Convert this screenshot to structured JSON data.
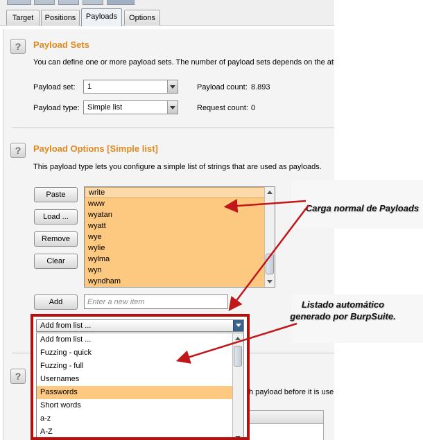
{
  "tabs": [
    {
      "label": "Target",
      "active": false
    },
    {
      "label": "Positions",
      "active": false
    },
    {
      "label": "Payloads",
      "active": true
    },
    {
      "label": "Options",
      "active": false
    }
  ],
  "payload_sets": {
    "help": "?",
    "title": "Payload Sets",
    "description": "You can define one or more payload sets. The number of payload sets depends on the att",
    "set_label": "Payload set:",
    "set_value": "1",
    "type_label": "Payload type:",
    "type_value": "Simple list",
    "count_label": "Payload count:",
    "count_value": "8.893",
    "request_label": "Request count:",
    "request_value": "0"
  },
  "payload_options": {
    "help": "?",
    "title": "Payload Options [Simple list]",
    "description": "This payload type lets you configure a simple list of strings that are used as payloads.",
    "buttons": {
      "paste": "Paste",
      "load": "Load ...",
      "remove": "Remove",
      "clear": "Clear",
      "add": "Add"
    },
    "items": [
      "write",
      "www",
      "wyatan",
      "wyatt",
      "wye",
      "wylie",
      "wylma",
      "wyn",
      "wyndham"
    ],
    "new_item_placeholder": "Enter a new item",
    "add_from_list": {
      "selected": "Add from list ...",
      "options": [
        "Add from list ...",
        "Fuzzing - quick",
        "Fuzzing - full",
        "Usernames",
        "Passwords",
        "Short words",
        "a-z",
        "A-Z"
      ],
      "highlighted": "Passwords"
    }
  },
  "processing": {
    "help": "?",
    "partial_text": "h payload before it is use"
  },
  "annotations": {
    "note1": "Carga normal de Payloads",
    "note2": "Listado automático generado por BurpSuite.",
    "arrow_color": "#c0171a"
  },
  "colors": {
    "accent_title": "#e08a1e",
    "list_background": "#fdc880",
    "frame_red": "#b80e0e"
  }
}
